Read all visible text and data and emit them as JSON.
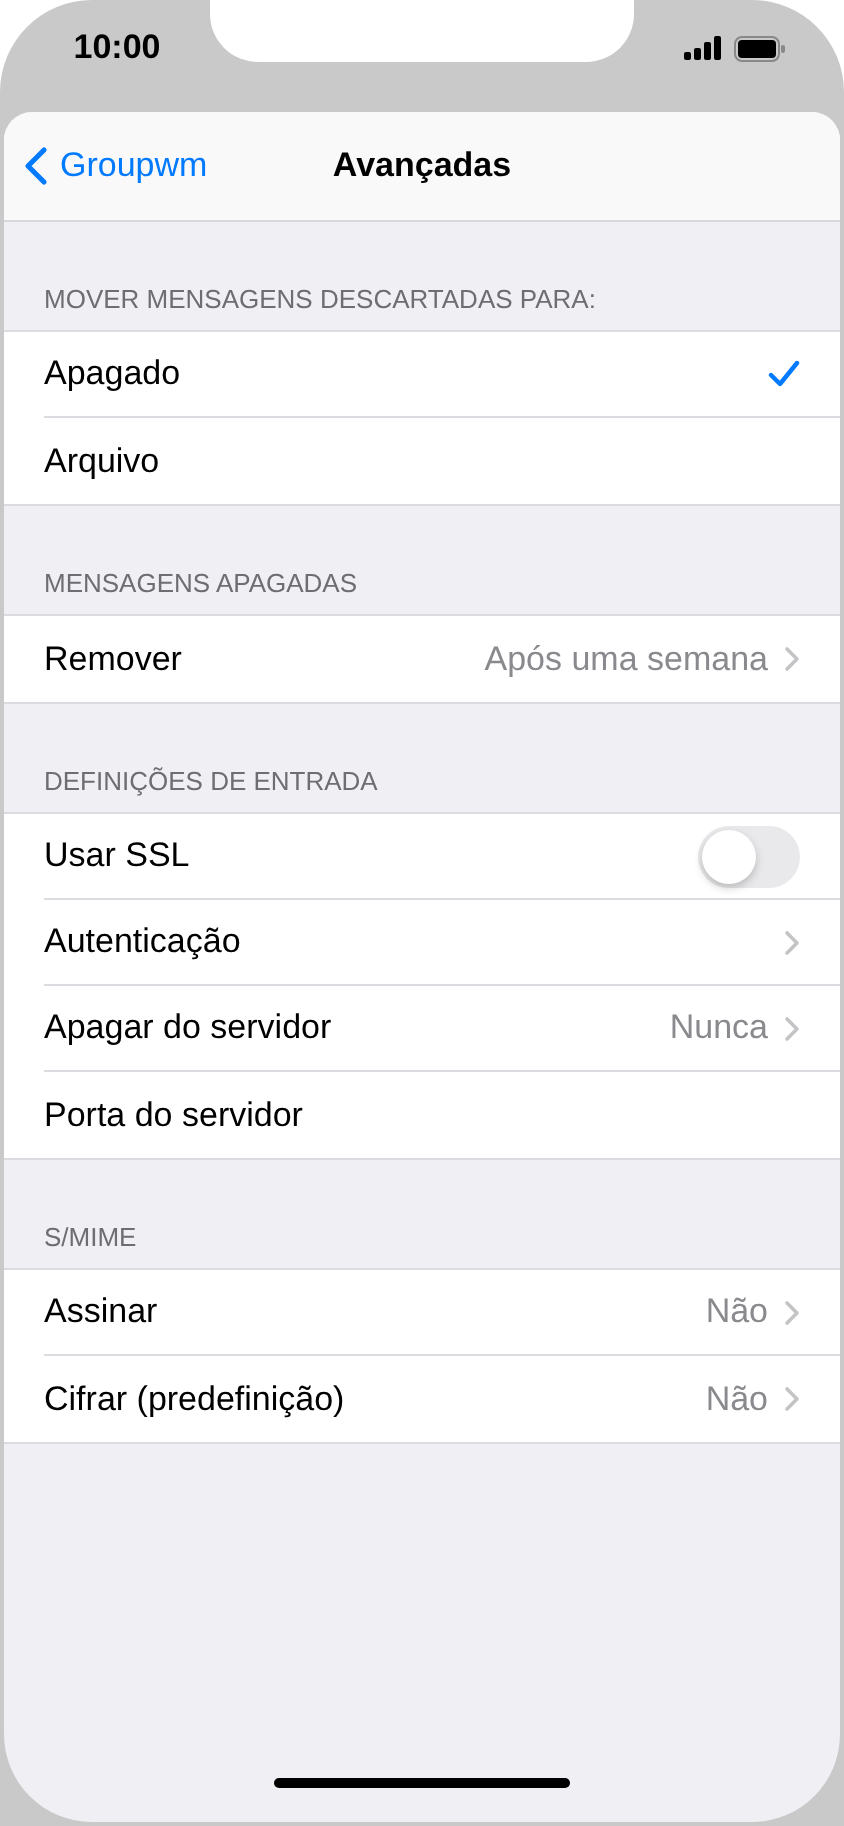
{
  "status_bar": {
    "time": "10:00"
  },
  "nav": {
    "back": "Groupwm",
    "title": "Avançadas"
  },
  "sections": [
    {
      "header": "MOVER MENSAGENS DESCARTADAS PARA:",
      "rows": [
        {
          "kind": "choice",
          "label": "Apagado",
          "selected": true
        },
        {
          "kind": "choice",
          "label": "Arquivo",
          "selected": false
        }
      ]
    },
    {
      "header": "MENSAGENS APAGADAS",
      "rows": [
        {
          "kind": "link",
          "label": "Remover",
          "value": "Após uma semana"
        }
      ]
    },
    {
      "header": "DEFINIÇÕES DE ENTRADA",
      "rows": [
        {
          "kind": "toggle",
          "label": "Usar SSL",
          "on": false
        },
        {
          "kind": "link",
          "label": "Autenticação"
        },
        {
          "kind": "link",
          "label": "Apagar do servidor",
          "value": "Nunca"
        },
        {
          "kind": "plain",
          "label": "Porta do servidor"
        }
      ]
    },
    {
      "header": "S/MIME",
      "rows": [
        {
          "kind": "link",
          "label": "Assinar",
          "value": "Não"
        },
        {
          "kind": "link",
          "label": "Cifrar (predefinição)",
          "value": "Não"
        }
      ]
    }
  ]
}
